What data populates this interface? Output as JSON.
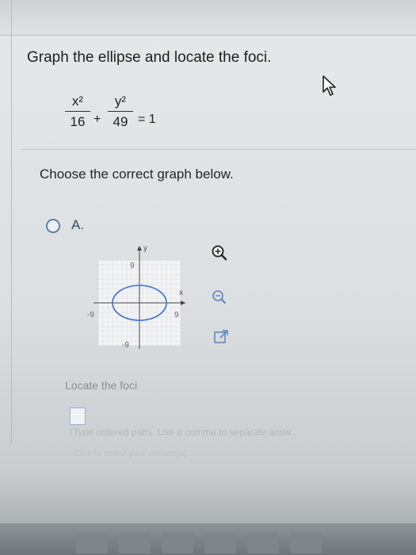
{
  "question": "Graph the ellipse and locate the foci.",
  "equation": {
    "term1_num": "x²",
    "term1_den": "16",
    "plus": "+",
    "term2_num": "y²",
    "term2_den": "49",
    "rhs": "= 1"
  },
  "prompt": "Choose the correct graph below.",
  "option_a": {
    "label": "A.",
    "graph": {
      "y_axis_label": "y",
      "x_axis_label": "x",
      "y_top_tick": "9",
      "y_bottom_tick": "-9",
      "x_left_tick": "-9",
      "x_right_tick": "9"
    }
  },
  "locate_label": "Locate the foci",
  "hint_text": "(Type ordered pairs. Use a comma to separate answ",
  "hint2_text": "Click to select your answer(s).",
  "colors": {
    "ellipse": "#3a6fcf",
    "radio": "#5a7fb0"
  },
  "icons": [
    "zoom-in-icon",
    "zoom-out-icon",
    "popout-icon",
    "cursor-icon"
  ]
}
